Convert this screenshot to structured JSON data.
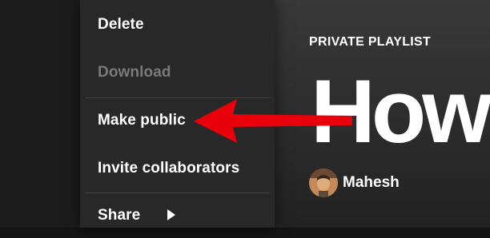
{
  "context_menu": {
    "items": [
      {
        "label": "Delete",
        "enabled": true
      },
      {
        "label": "Download",
        "enabled": false
      },
      {
        "label": "Make public",
        "enabled": true
      },
      {
        "label": "Invite collaborators",
        "enabled": true
      },
      {
        "label": "Share",
        "enabled": true,
        "has_submenu": true
      }
    ]
  },
  "playlist": {
    "type_label": "PRIVATE PLAYLIST",
    "title": "How",
    "owner": "Mahesh"
  },
  "colors": {
    "menu_bg": "#282828",
    "disabled_text": "#7a7a7a",
    "annotation_arrow": "#e8000b"
  }
}
